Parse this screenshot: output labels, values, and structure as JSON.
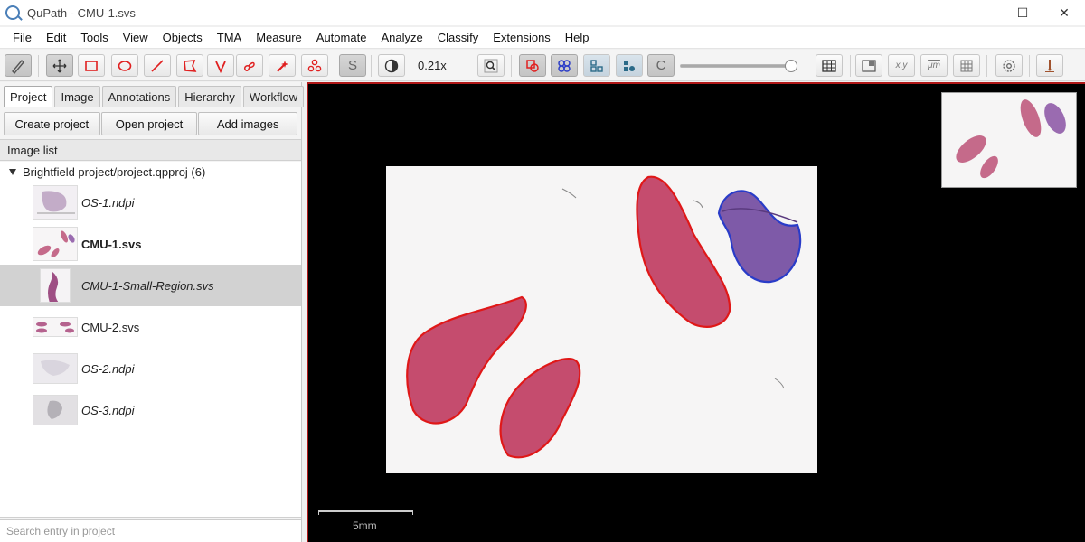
{
  "window": {
    "title": "QuPath - CMU-1.svs",
    "controls": {
      "minimize": "—",
      "maximize": "☐",
      "close": "✕"
    }
  },
  "menu": [
    "File",
    "Edit",
    "Tools",
    "View",
    "Objects",
    "TMA",
    "Measure",
    "Automate",
    "Analyze",
    "Classify",
    "Extensions",
    "Help"
  ],
  "toolbar": {
    "zoom_label": "0.21x",
    "brightness_level": 0.95,
    "tools": [
      "pen-measure-icon",
      "move-icon",
      "rectangle-icon",
      "ellipse-icon",
      "line-icon",
      "polygon-icon",
      "polyline-icon",
      "brush-icon",
      "wand-icon",
      "points-icon",
      "selection-mode-icon",
      "brightness-contrast-icon",
      "zoom-to-fit-icon",
      "show-annotations-icon",
      "show-tma-grid-icon",
      "show-detections-icon",
      "fill-detections-icon",
      "show-pixel-classification-icon",
      "measurement-table-icon",
      "overview-icon",
      "location-icon",
      "scalebar-icon",
      "grid-icon",
      "preferences-icon",
      "log-icon"
    ],
    "xy_label": "x,y",
    "um_label": "μm",
    "s_label": "S",
    "c_label": "C"
  },
  "left_panel": {
    "tabs": [
      "Project",
      "Image",
      "Annotations",
      "Hierarchy",
      "Workflow"
    ],
    "active_tab": "Project",
    "buttons": {
      "create": "Create project",
      "open": "Open project",
      "add": "Add images"
    },
    "list_header": "Image list",
    "project_root": "Brightfield project/project.qpproj (6)",
    "entries": [
      {
        "name": "OS-1.ndpi",
        "style": "italic"
      },
      {
        "name": "CMU-1.svs",
        "style": "bold"
      },
      {
        "name": "CMU-1-Small-Region.svs",
        "style": "italic"
      },
      {
        "name": "CMU-2.svs",
        "style": "normal"
      },
      {
        "name": "OS-2.ndpi",
        "style": "italic"
      },
      {
        "name": "OS-3.ndpi",
        "style": "italic"
      }
    ],
    "selected_entry": "CMU-1-Small-Region.svs",
    "search_placeholder": "Search entry in project"
  },
  "viewer": {
    "scalebar_label": "5mm",
    "colors": {
      "annotation_red": "#e01818",
      "annotation_blue": "#2a3cc8",
      "tissue_pink": "#c54c6e",
      "tissue_purple": "#7e5aa8",
      "background": "#000000",
      "frame": "#b01818"
    }
  }
}
